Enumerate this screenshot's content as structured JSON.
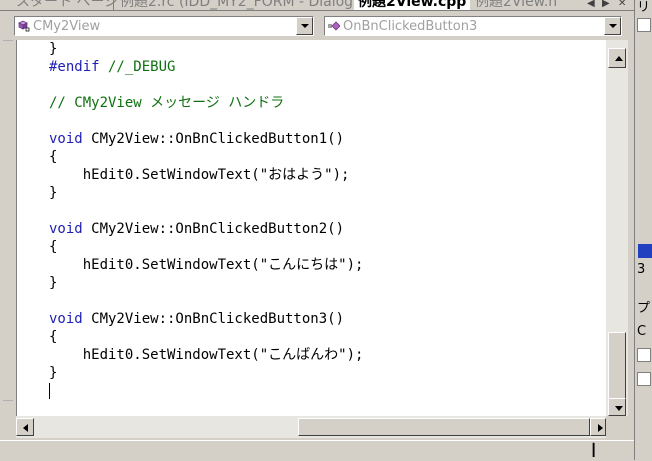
{
  "tabs": [
    {
      "label": "スタート ページ",
      "active": false
    },
    {
      "label": "例題2.rc (IDD_MY2_FORM - Dialog)",
      "active": false
    },
    {
      "label": "例題2View.cpp",
      "active": true
    },
    {
      "label": "例題2View.h",
      "active": false
    }
  ],
  "navigation": {
    "class_combo": "CMy2View",
    "member_combo": "OnBnClickedButton3"
  },
  "editor": {
    "lines": [
      {
        "tokens": [
          {
            "t": "}",
            "c": ""
          }
        ]
      },
      {
        "tokens": [
          {
            "t": "#endif",
            "c": "pp"
          },
          {
            "t": " //_DEBUG",
            "c": "cm"
          }
        ]
      },
      {
        "tokens": []
      },
      {
        "tokens": [
          {
            "t": "// CMy2View メッセージ ハンドラ",
            "c": "cm"
          }
        ]
      },
      {
        "tokens": []
      },
      {
        "tokens": [
          {
            "t": "void",
            "c": "kw"
          },
          {
            "t": " CMy2View::OnBnClickedButton1()",
            "c": ""
          }
        ]
      },
      {
        "tokens": [
          {
            "t": "{",
            "c": ""
          }
        ]
      },
      {
        "tokens": [
          {
            "t": "    hEdit0.SetWindowText(\"おはよう\");",
            "c": ""
          }
        ]
      },
      {
        "tokens": [
          {
            "t": "}",
            "c": ""
          }
        ]
      },
      {
        "tokens": []
      },
      {
        "tokens": [
          {
            "t": "void",
            "c": "kw"
          },
          {
            "t": " CMy2View::OnBnClickedButton2()",
            "c": ""
          }
        ]
      },
      {
        "tokens": [
          {
            "t": "{",
            "c": ""
          }
        ]
      },
      {
        "tokens": [
          {
            "t": "    hEdit0.SetWindowText(\"こんにちは\");",
            "c": ""
          }
        ]
      },
      {
        "tokens": [
          {
            "t": "}",
            "c": ""
          }
        ]
      },
      {
        "tokens": []
      },
      {
        "tokens": [
          {
            "t": "void",
            "c": "kw"
          },
          {
            "t": " CMy2View::OnBnClickedButton3()",
            "c": ""
          }
        ]
      },
      {
        "tokens": [
          {
            "t": "{",
            "c": ""
          }
        ]
      },
      {
        "tokens": [
          {
            "t": "    hEdit0.SetWindowText(\"こんばんわ\");",
            "c": ""
          }
        ]
      },
      {
        "tokens": [
          {
            "t": "}",
            "c": ""
          }
        ]
      },
      {
        "tokens": []
      }
    ],
    "caret_line": 19
  },
  "right_panel": {
    "items": [
      "リ",
      "3",
      "プ",
      "C"
    ]
  },
  "icons": {
    "class_icon": "class-icon",
    "method_icon": "method-icon"
  },
  "colors": {
    "keyword": "#1e1eb4",
    "comment": "#107010",
    "chrome": "#d4d0c8"
  }
}
